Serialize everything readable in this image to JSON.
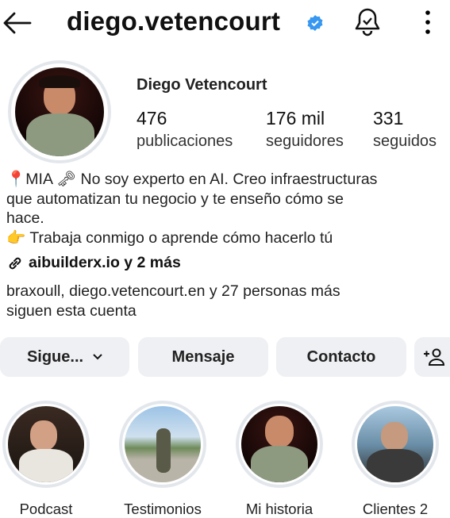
{
  "header": {
    "username": "diego.vetencourt",
    "verified": true,
    "icons": [
      "back-arrow-icon",
      "verified-badge-icon",
      "bell-icon",
      "more-icon"
    ]
  },
  "profile": {
    "name": "Diego Vetencourt",
    "stats": [
      {
        "value": "476",
        "label": "publicaciones"
      },
      {
        "value": "176 mil",
        "label": "seguidores"
      },
      {
        "value": "331",
        "label": "seguidos"
      }
    ]
  },
  "bio": {
    "line1": "MIA",
    "line1b": "No soy experto en AI. Creo infraestructuras",
    "line2": "que automatizan tu negocio y te enseño cómo se",
    "line3": "hace.",
    "line4": "Trabaja conmigo o aprende cómo hacerlo tú",
    "link": "aibuilderx.io y 2 más"
  },
  "followed_by": {
    "line1": "braxoull, diego.vetencourt.en y 27 personas más",
    "line2": "siguen esta cuenta"
  },
  "buttons": {
    "following": "Sigue...",
    "message": "Mensaje",
    "contact": "Contacto"
  },
  "highlights": [
    {
      "label": "Podcast"
    },
    {
      "label": "Testimonios"
    },
    {
      "label": "Mi historia"
    },
    {
      "label": "Clientes 2"
    }
  ],
  "colors": {
    "verified": "#3897f0",
    "button_bg": "#eff0f3"
  }
}
